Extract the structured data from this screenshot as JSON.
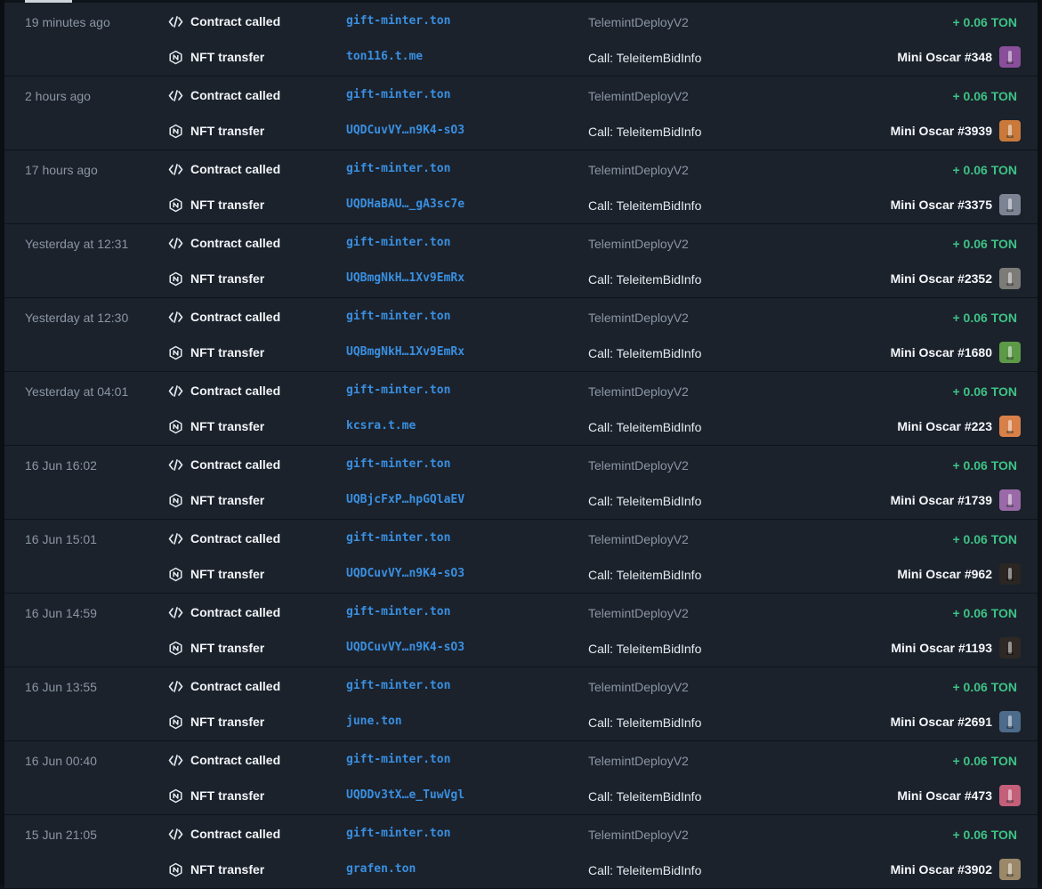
{
  "labels": {
    "contract_called": "Contract called",
    "nft_transfer": "NFT transfer",
    "call_desc": "Call: TeleitemBidInfo",
    "contract_desc": "TelemintDeployV2",
    "contract_addr": "gift-minter.ton",
    "amount": "+ 0.06 TON"
  },
  "icons": {
    "contract": "code-brackets-icon",
    "nft": "nft-diamond-icon"
  },
  "colors": {
    "background": "#1b222c",
    "link": "#3a8fe0",
    "positive": "#3ec285",
    "muted": "#8b96a3"
  },
  "transactions": [
    {
      "time": "19 minutes ago",
      "to": "ton116.t.me",
      "nft": "Mini Oscar #348",
      "thumb": "#8a4f9a"
    },
    {
      "time": "2 hours ago",
      "to": "UQDCuvVY…n9K4-sO3",
      "nft": "Mini Oscar #3939",
      "thumb": "#c97a3a"
    },
    {
      "time": "17 hours ago",
      "to": "UQDHaBAU…_gA3sc7e",
      "nft": "Mini Oscar #3375",
      "thumb": "#7c8494"
    },
    {
      "time": "Yesterday at 12:31",
      "to": "UQBmgNkH…1Xv9EmRx",
      "nft": "Mini Oscar #2352",
      "thumb": "#7d7b78"
    },
    {
      "time": "Yesterday at 12:30",
      "to": "UQBmgNkH…1Xv9EmRx",
      "nft": "Mini Oscar #1680",
      "thumb": "#5d9a48"
    },
    {
      "time": "Yesterday at 04:01",
      "to": "kcsra.t.me",
      "nft": "Mini Oscar #223",
      "thumb": "#d8804a"
    },
    {
      "time": "16 Jun 16:02",
      "to": "UQBjcFxP…hpGQlaEV",
      "nft": "Mini Oscar #1739",
      "thumb": "#9a6aa8"
    },
    {
      "time": "16 Jun 15:01",
      "to": "UQDCuvVY…n9K4-sO3",
      "nft": "Mini Oscar #962",
      "thumb": "#2b2622"
    },
    {
      "time": "16 Jun 14:59",
      "to": "UQDCuvVY…n9K4-sO3",
      "nft": "Mini Oscar #1193",
      "thumb": "#2e2924"
    },
    {
      "time": "16 Jun 13:55",
      "to": "june.ton",
      "nft": "Mini Oscar #2691",
      "thumb": "#4d6b8a"
    },
    {
      "time": "16 Jun 00:40",
      "to": "UQDDv3tX…e_TuwVgl",
      "nft": "Mini Oscar #473",
      "thumb": "#c45f7a"
    },
    {
      "time": "15 Jun 21:05",
      "to": "grafen.ton",
      "nft": "Mini Oscar #3902",
      "thumb": "#9a8868"
    }
  ]
}
